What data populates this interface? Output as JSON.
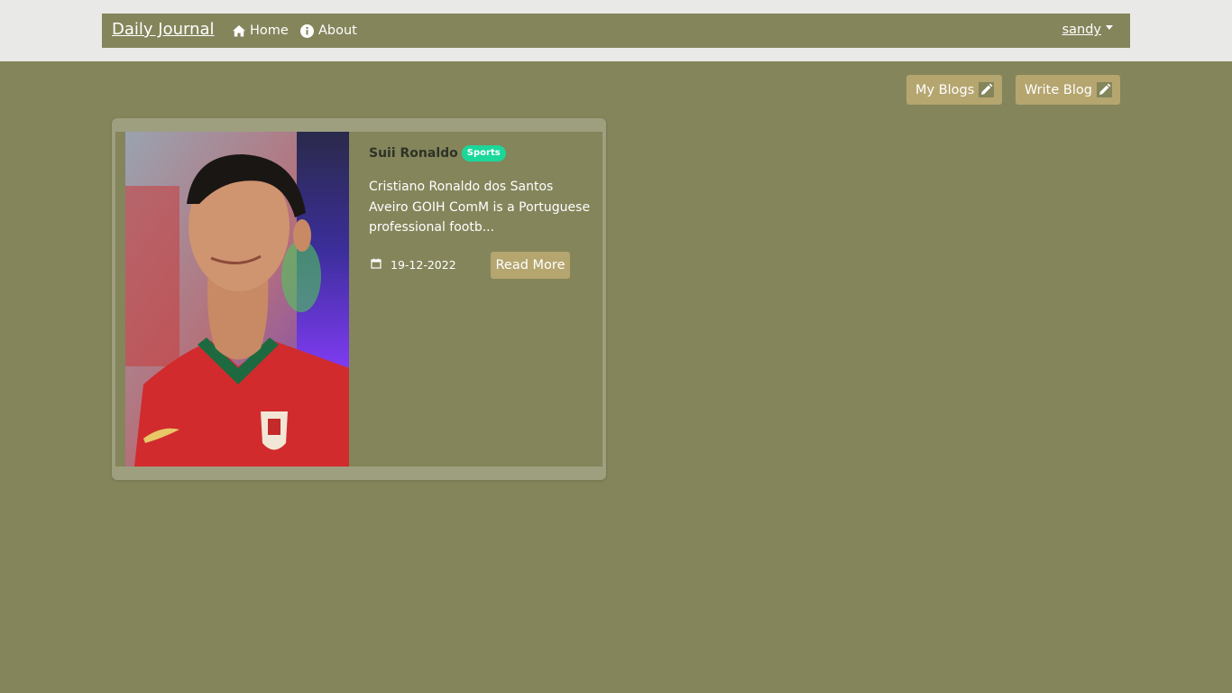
{
  "navbar": {
    "brand": "Daily Journal",
    "links": [
      {
        "label": "Home",
        "icon": "home-icon"
      },
      {
        "label": "About",
        "icon": "info-icon"
      }
    ],
    "user": {
      "name": "sandy",
      "icon": "caret-down-icon"
    }
  },
  "actions": {
    "my_blogs": {
      "label": "My Blogs",
      "icon": "pencil-icon"
    },
    "write_blog": {
      "label": "Write Blog",
      "icon": "pencil-icon"
    }
  },
  "posts": [
    {
      "title": "Suii Ronaldo",
      "category": "Sports",
      "excerpt": "Cristiano Ronaldo dos Santos Aveiro GOIH ComM is a Portuguese professional footb...",
      "date": "19-12-2022",
      "date_icon": "calendar-icon",
      "read_more_label": "Read More"
    }
  ],
  "colors": {
    "page_background": "#84855B",
    "topbar_background": "#E9E9E7",
    "button": "#B5A56F",
    "card_frame": "#9E9F7F",
    "badge": "#1BD79A"
  }
}
